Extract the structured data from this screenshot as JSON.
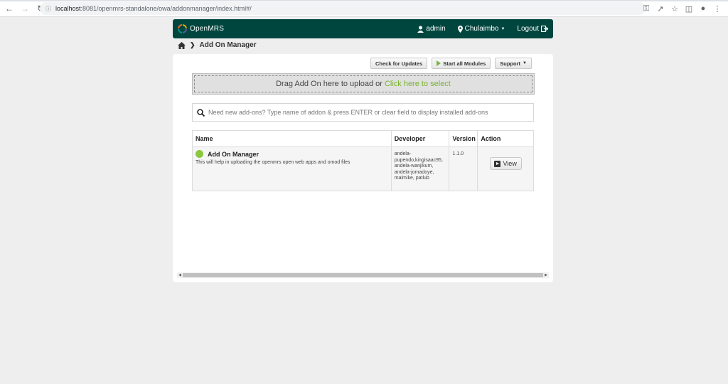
{
  "browser": {
    "url_host": "localhost",
    "url_rest": ":8081/openmrs-standalone/owa/addonmanager/index.html#/"
  },
  "header": {
    "logo_text": "OpenMRS",
    "user": "admin",
    "location": "Chulaimbo",
    "logout": "Logout"
  },
  "breadcrumb": {
    "current": "Add On Manager"
  },
  "toolbar": {
    "check_updates": "Check for Updates",
    "start_all": "Start all Modules",
    "support": "Support"
  },
  "dropzone": {
    "text": "Drag Add On here to upload or",
    "link": "Click here to select"
  },
  "search": {
    "placeholder": "Need new add-ons? Type name of addon & press ENTER or clear field to display installed add-ons"
  },
  "table": {
    "headers": [
      "Name",
      "Developer",
      "Version",
      "Action"
    ],
    "rows": [
      {
        "name": "Add On Manager",
        "description": "This will help in uploading the openmrs open web apps and omod files",
        "developer_lines": [
          "andela-",
          "pupendo,kingisaac95,",
          "andela-wanjikum,",
          "andela-jomadoye,",
          "malmike, patlub"
        ],
        "version": "1.1.0",
        "action": "View",
        "status_color": "#8dc63f"
      }
    ]
  },
  "colors": {
    "header_bg": "#00463f",
    "accent_green": "#7ab32e"
  }
}
